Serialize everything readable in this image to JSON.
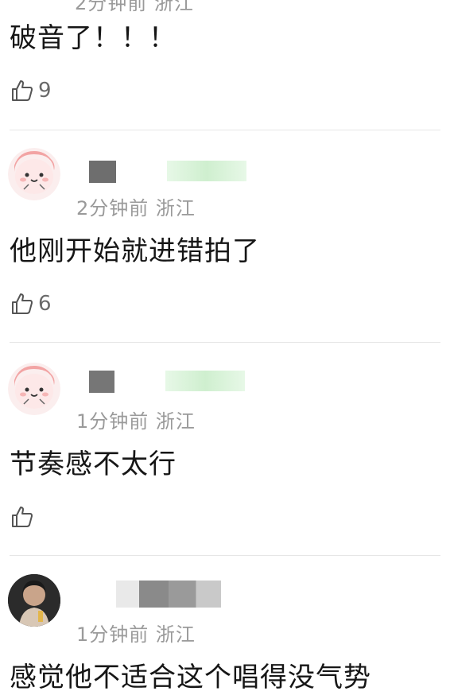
{
  "top_meta": "2分钟前 浙江",
  "comments": [
    {
      "text": "破音了！！！",
      "likes": "9"
    },
    {
      "meta": "2分钟前 浙江",
      "text": "他刚开始就进错拍了",
      "likes": "6"
    },
    {
      "meta": "1分钟前 浙江",
      "text": "节奏感不太行",
      "likes": ""
    },
    {
      "meta": "1分钟前 浙江",
      "text": "感觉他不适合这个唱得没气势"
    }
  ],
  "colors": {
    "text": "#161616",
    "meta": "#9a9a9a",
    "divider": "#e6e6e6",
    "avatar_pink": "#f6d6d6",
    "badge_green": "#d9f5d9"
  }
}
